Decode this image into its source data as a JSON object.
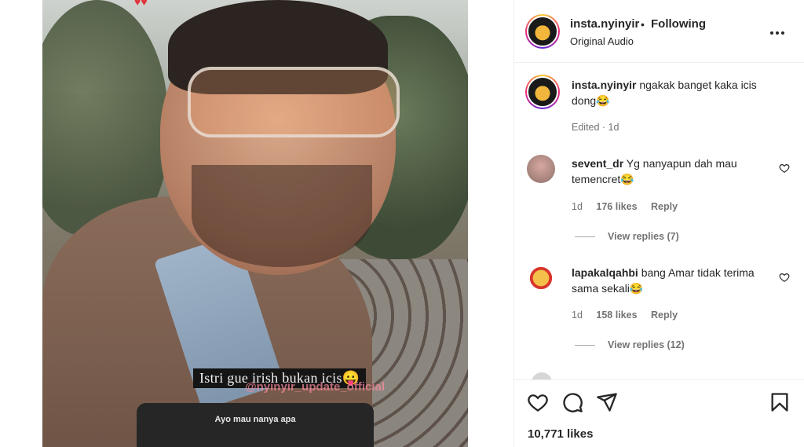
{
  "post": {
    "username": "insta.nyinyir",
    "separator": "•",
    "follow_status": "Following",
    "audio": "Original Audio",
    "more_label": "•••"
  },
  "media": {
    "caption_overlay": "Istri gue irish bukan icis😛",
    "watermark": "@nyinyir_update_official",
    "ask_box_text": "Ayo mau nanya apa"
  },
  "caption_comment": {
    "username": "insta.nyinyir",
    "text": "ngakak banget kaka icis dong😂",
    "meta": "Edited · 1d"
  },
  "comments": [
    {
      "username": "sevent_dr",
      "text": "Yg nanyapun dah mau temencret😂",
      "time": "1d",
      "likes": "176 likes",
      "reply": "Reply",
      "view_replies": "View replies (7)"
    },
    {
      "username": "lapakalqahbi",
      "text": "bang Amar tidak terima sama sekali😂",
      "time": "1d",
      "likes": "158 likes",
      "reply": "Reply",
      "view_replies": "View replies (12)"
    }
  ],
  "actions": {
    "like_icon": "heart-icon",
    "comment_icon": "comment-icon",
    "share_icon": "share-icon",
    "save_icon": "bookmark-icon"
  },
  "likes_count": "10,771 likes"
}
